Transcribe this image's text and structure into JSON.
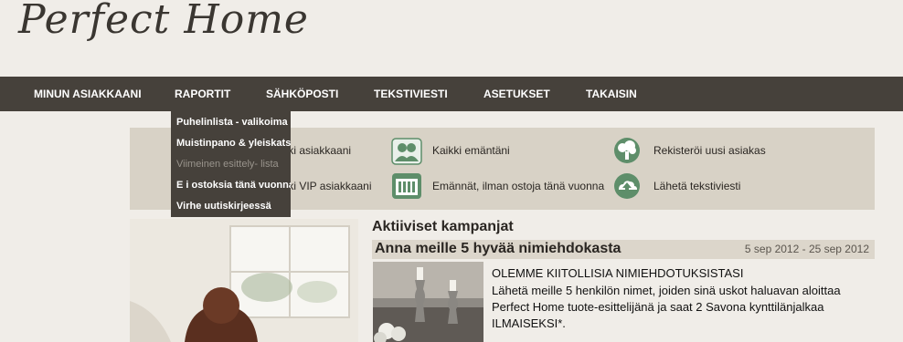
{
  "brand": {
    "logo_text": "Perfect Home"
  },
  "nav": {
    "items": [
      "MINUN ASIAKKAANI",
      "RAPORTIT",
      "SÄHKÖPOSTI",
      "TEKSTIVIESTI",
      "ASETUKSET",
      "TAKAISIN"
    ]
  },
  "dropdown": {
    "items": [
      "Puhelinlista - valikoima",
      "Muistinpano & yleiskatsaus",
      "Viimeinen esittely- lista",
      "E i ostoksia tänä vuonna",
      "Virhe uutiskirjeessä"
    ]
  },
  "quick_links": {
    "items": [
      {
        "label": "Kaikki asiakkaani",
        "icon": "people-icon"
      },
      {
        "label": "Kaikki emäntäni",
        "icon": "group-icon"
      },
      {
        "label": "Rekisteröi uusi asiakas",
        "icon": "tree-cloud-icon"
      },
      {
        "label": "Kaikki VIP asiakkaani",
        "icon": "vip-icon"
      },
      {
        "label": "Emännät, ilman ostoja tänä vuonna",
        "icon": "calendar-icon"
      },
      {
        "label": "Lähetä tekstiviesti",
        "icon": "cloud-upload-icon"
      }
    ]
  },
  "campaigns": {
    "section_title": "Aktiiviset kampanjat",
    "item": {
      "title": "Anna meille 5 hyvää nimiehdokasta",
      "date": "5 sep 2012 - 25 sep 2012",
      "heading": "OLEMME KIITOLLISIA NIMIEHDOTUKSISTASI",
      "body": "Lähetä meille 5 henkilön nimet, joiden sinä uskot haluavan aloittaa Perfect Home tuote-esittelijänä ja saat 2 Savona kynttilänjalkaa ILMAISEKSI*."
    }
  },
  "colors": {
    "nav_bg": "#46413b",
    "panel_bg": "#d8d2c6",
    "icon_green": "#5e8e6a",
    "page_bg": "#f0ede8"
  }
}
